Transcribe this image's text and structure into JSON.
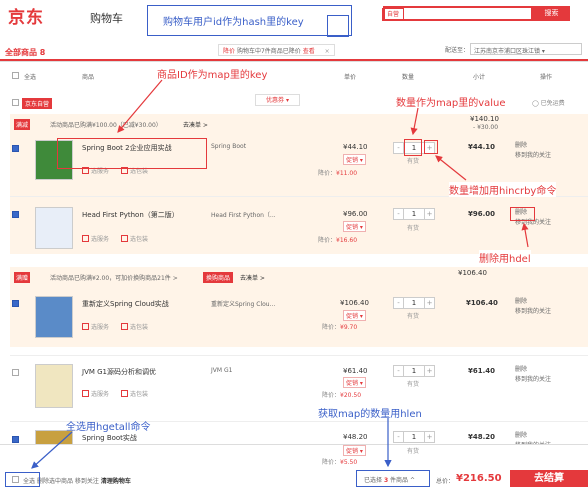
{
  "header": {
    "logo": "京东",
    "subtitle": "购物车",
    "search_placeholder": "自营",
    "search_button": "搜索"
  },
  "tabs": {
    "all_label": "全部商品",
    "all_count": "8"
  },
  "promo_bar": {
    "tag": "降价",
    "text": "购物车中7件商品已降价",
    "link": "查看",
    "close": "×"
  },
  "shipping": {
    "label": "配送至：",
    "value": "江苏南京市浦口区珠江镇 ▾"
  },
  "columns": {
    "select_all": "全选",
    "product": "商品",
    "price": "单价",
    "qty": "数量",
    "subtotal": "小计",
    "ops": "操作"
  },
  "shop": {
    "tag": "京东自营",
    "coupon": "优惠券 ▾",
    "free": "已免运费"
  },
  "group1": {
    "badge": "满减",
    "text": "活动商品已购满¥100.00（已减¥30.00）",
    "link": "去凑单 >",
    "total": "¥140.10",
    "discount": "- ¥30.00"
  },
  "group2": {
    "badge": "满赠",
    "text": "活动商品已购满¥2.00，可加价换购商品21件 >",
    "link_tag": "换购商品",
    "link": "去凑单 >",
    "total": "¥106.40"
  },
  "items": [
    {
      "title": "Spring Boot 2企业应用实战",
      "attr": "Spring Boot",
      "price": "¥44.10",
      "promo": "促销 ▾",
      "dlabel": "降价：",
      "dprice": "¥11.00",
      "qty": "1",
      "stock": "有货",
      "subtotal": "¥44.10",
      "del": "删除",
      "fav": "移到我的关注",
      "svc1": "选服务",
      "svc2": "选包装"
    },
    {
      "title": "Head First Python（第二版）",
      "attr": "Head First Python（...",
      "price": "¥96.00",
      "promo": "促销 ▾",
      "dlabel": "降价：",
      "dprice": "¥16.60",
      "qty": "1",
      "stock": "有货",
      "subtotal": "¥96.00",
      "del": "删除",
      "fav": "移到我的关注",
      "svc1": "选服务",
      "svc2": "选包装"
    },
    {
      "title": "重新定义Spring Cloud实战",
      "attr": "重新定义Spring Clou...",
      "price": "¥106.40",
      "promo": "促销 ▾",
      "dlabel": "降价：",
      "dprice": "¥9.70",
      "qty": "1",
      "stock": "有货",
      "subtotal": "¥106.40",
      "del": "删除",
      "fav": "移到我的关注",
      "svc1": "选服务",
      "svc2": "选包装"
    },
    {
      "title": "JVM G1源码分析和调优",
      "attr": "JVM G1",
      "price": "¥61.40",
      "promo": "促销 ▾",
      "dlabel": "降价：",
      "dprice": "¥20.50",
      "qty": "1",
      "stock": "有货",
      "subtotal": "¥61.40",
      "del": "删除",
      "fav": "移到我的关注",
      "svc1": "选服务",
      "svc2": "选包装"
    },
    {
      "title": "Spring Boot实战",
      "attr": "",
      "price": "¥48.20",
      "promo": "促销 ▾",
      "dlabel": "降价：",
      "dprice": "¥5.50",
      "qty": "1",
      "stock": "有货",
      "subtotal": "¥48.20",
      "del": "删除",
      "fav": "移到我的关注",
      "svc1": "选服务",
      "svc2": "选包装"
    }
  ],
  "footer": {
    "select_all": "全选",
    "delete": "删除选中商品",
    "move": "移到关注",
    "clear": "清理购物车",
    "selected": "已选择",
    "selected_count": "3",
    "selected_unit": "件商品 ^",
    "total_label": "总价：",
    "total": "¥216.50",
    "checkout": "去结算"
  },
  "annotations": {
    "hash_key": "购物车用户id作为hash里的key",
    "map_key": "商品ID作为map里的key",
    "map_value": "数量作为map里的value",
    "hincrby": "数量增加用hincrby命令",
    "hdel": "删除用hdel",
    "hlen": "获取map的数量用hlen",
    "hgetall": "全选用hgetall命令"
  }
}
